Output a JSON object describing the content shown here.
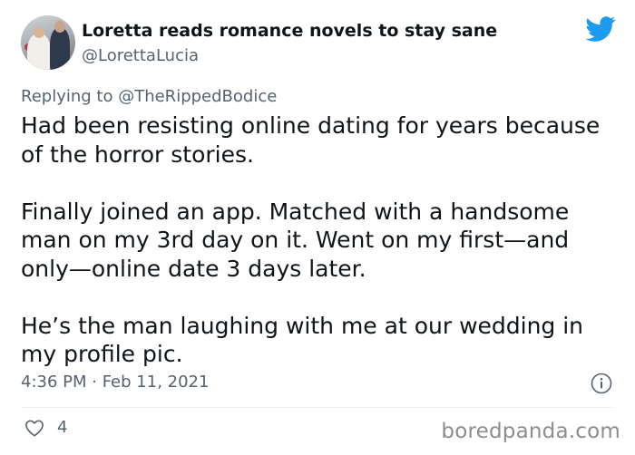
{
  "author": {
    "display_name": "Loretta reads romance novels to stay sane",
    "handle": "@LorettaLucia",
    "avatar_icon": "avatar-photo"
  },
  "reply": {
    "prefix": "Replying to ",
    "mention": "@TheRippedBodice"
  },
  "tweet": {
    "lines": [
      "Had been resisting online dating for years because",
      "of the horror stories.",
      "",
      "Finally joined an app. Matched with a handsome",
      "man on my 3rd day on it. Went on my first—and",
      "only—online date 3 days later.",
      "",
      "He’s the man laughing with me at our wedding in",
      "my profile pic."
    ],
    "timestamp": "4:36 PM · Feb 11, 2021"
  },
  "actions": {
    "like_count": "4",
    "like_icon": "heart-icon",
    "info_icon": "info-icon"
  },
  "watermark": "boredpanda.com",
  "colors": {
    "twitter_blue": "#1d9bf0",
    "secondary_text": "#536471",
    "primary_text": "#0f1419"
  }
}
